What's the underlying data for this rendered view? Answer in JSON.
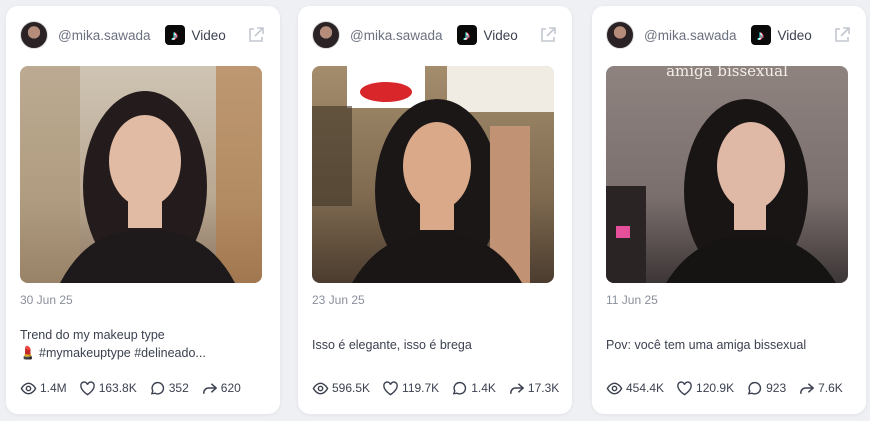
{
  "cards": [
    {
      "username": "@mika.sawada",
      "type": "Video",
      "platform_icon": "tiktok-icon",
      "date": "30 Jun 25",
      "caption_line1": "Trend do my makeup type",
      "caption_line2": "💄 #mymakeuptype #delineado...",
      "overlay_text": "",
      "stats": {
        "views": "1.4M",
        "likes": "163.8K",
        "comments": "352",
        "shares": "620"
      }
    },
    {
      "username": "@mika.sawada",
      "type": "Video",
      "platform_icon": "tiktok-icon",
      "date": "23 Jun 25",
      "caption_line1": "Isso é elegante, isso é brega",
      "caption_line2": "",
      "overlay_text": "",
      "stats": {
        "views": "596.5K",
        "likes": "119.7K",
        "comments": "1.4K",
        "shares": "17.3K"
      }
    },
    {
      "username": "@mika.sawada",
      "type": "Video",
      "platform_icon": "tiktok-icon",
      "date": "11 Jun 25",
      "caption_line1": "Pov: você tem uma amiga bissexual",
      "caption_line2": "",
      "overlay_text": "amiga bissexual",
      "stats": {
        "views": "454.4K",
        "likes": "120.9K",
        "comments": "923",
        "shares": "7.6K"
      }
    }
  ],
  "colors": {
    "background": "#eef0f4",
    "card": "#ffffff",
    "text": "#3c4150",
    "muted": "#8a8f9c"
  }
}
